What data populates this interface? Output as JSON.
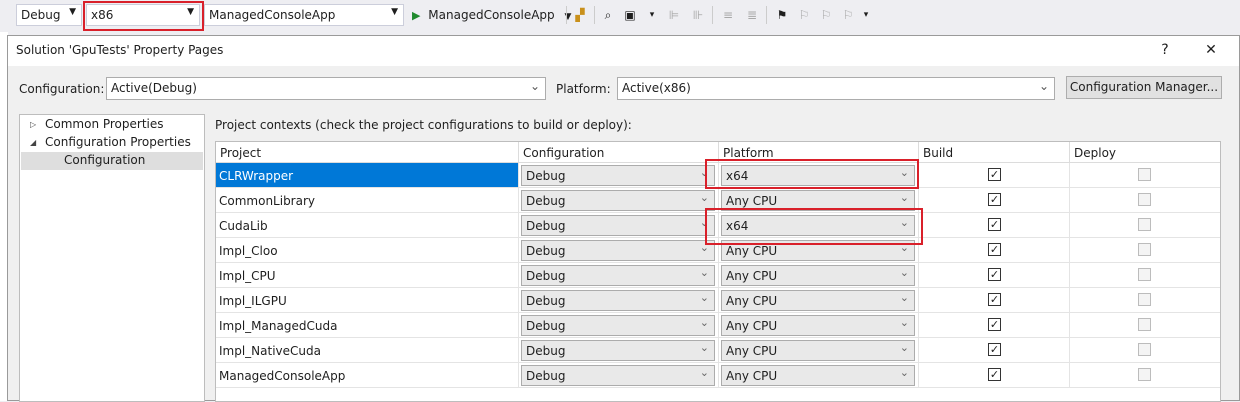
{
  "toolbar": {
    "config_value": "Debug",
    "platform_value": "x86",
    "startup_project": "ManagedConsoleApp",
    "run_target": "ManagedConsoleApp"
  },
  "dialog": {
    "title": "Solution 'GpuTests' Property Pages",
    "help_glyph": "?",
    "close_glyph": "✕",
    "configuration_label": "Configuration:",
    "configuration_value": "Active(Debug)",
    "platform_label": "Platform:",
    "platform_value": "Active(x86)",
    "config_manager_label": "Configuration Manager...",
    "tree": [
      {
        "label": "Common Properties",
        "expanded": false
      },
      {
        "label": "Configuration Properties",
        "expanded": true
      },
      {
        "label": "Configuration",
        "selected": true
      }
    ],
    "contexts_label": "Project contexts (check the project configurations to build or deploy):",
    "columns": [
      "Project",
      "Configuration",
      "Platform",
      "Build",
      "Deploy"
    ],
    "rows": [
      {
        "project": "CLRWrapper",
        "configuration": "Debug",
        "platform": "x64",
        "build": true,
        "deploy": false
      },
      {
        "project": "CommonLibrary",
        "configuration": "Debug",
        "platform": "Any CPU",
        "build": true,
        "deploy": false
      },
      {
        "project": "CudaLib",
        "configuration": "Debug",
        "platform": "x64",
        "build": true,
        "deploy": false
      },
      {
        "project": "Impl_Cloo",
        "configuration": "Debug",
        "platform": "Any CPU",
        "build": true,
        "deploy": false
      },
      {
        "project": "Impl_CPU",
        "configuration": "Debug",
        "platform": "Any CPU",
        "build": true,
        "deploy": false
      },
      {
        "project": "Impl_ILGPU",
        "configuration": "Debug",
        "platform": "Any CPU",
        "build": true,
        "deploy": false
      },
      {
        "project": "Impl_ManagedCuda",
        "configuration": "Debug",
        "platform": "Any CPU",
        "build": true,
        "deploy": false
      },
      {
        "project": "Impl_NativeCuda",
        "configuration": "Debug",
        "platform": "Any CPU",
        "build": true,
        "deploy": false
      },
      {
        "project": "ManagedConsoleApp",
        "configuration": "Debug",
        "platform": "Any CPU",
        "build": true,
        "deploy": false
      }
    ]
  },
  "colors": {
    "selection": "#0078d7",
    "highlight_box": "#d9202a",
    "run_icon": "#1f8a2e"
  }
}
